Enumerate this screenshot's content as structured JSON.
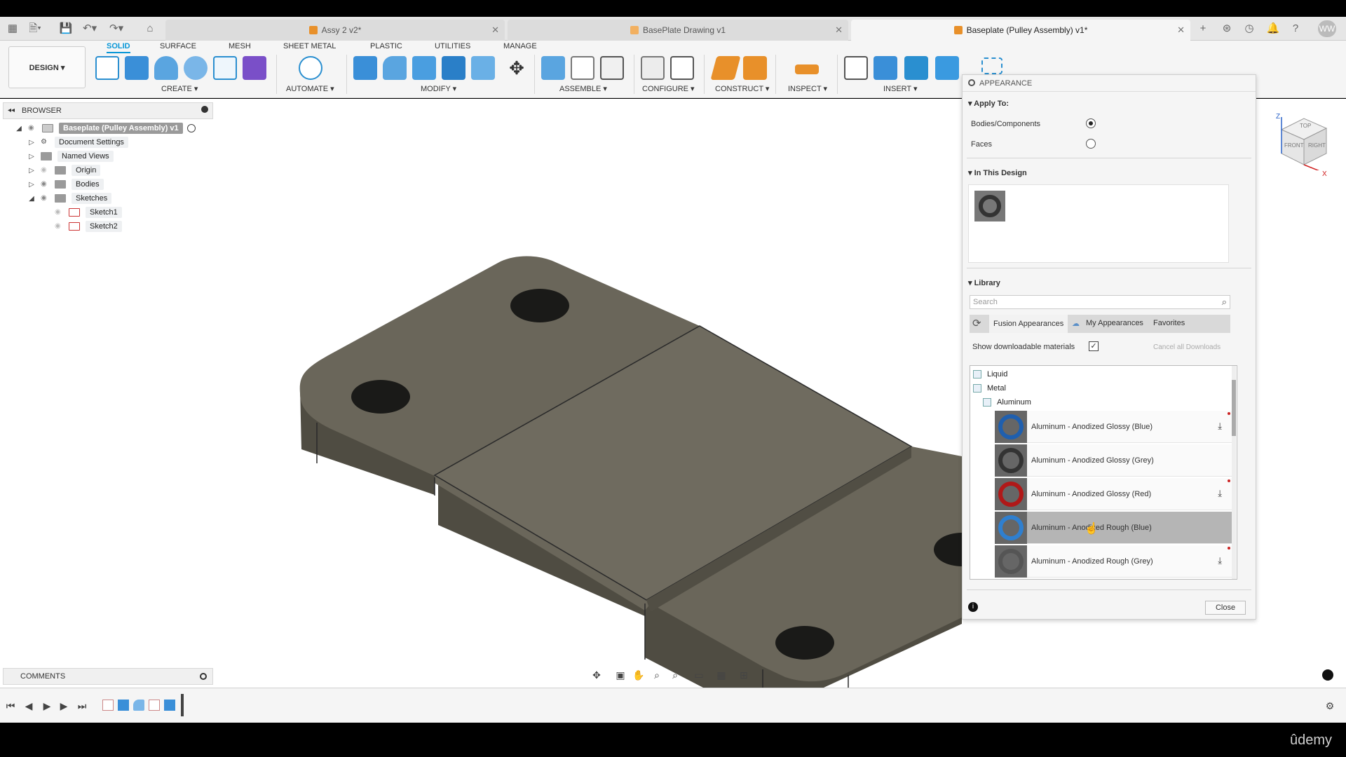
{
  "tabs": [
    {
      "label": "Assy 2 v2*"
    },
    {
      "label": "BasePlate Drawing v1"
    },
    {
      "label": "Baseplate (Pulley Assembly) v1*"
    }
  ],
  "user_initials": "WW",
  "workspace_tabs": [
    "SOLID",
    "SURFACE",
    "MESH",
    "SHEET METAL",
    "PLASTIC",
    "UTILITIES",
    "MANAGE"
  ],
  "design_button": "DESIGN ▾",
  "groups": [
    "CREATE ▾",
    "AUTOMATE ▾",
    "MODIFY ▾",
    "ASSEMBLE ▾",
    "CONFIGURE ▾",
    "CONSTRUCT ▾",
    "INSPECT ▾",
    "INSERT ▾"
  ],
  "browser": {
    "title": "BROWSER",
    "root": "Baseplate (Pulley Assembly) v1",
    "items": [
      {
        "label": "Document Settings"
      },
      {
        "label": "Named Views"
      },
      {
        "label": "Origin"
      },
      {
        "label": "Bodies"
      },
      {
        "label": "Sketches"
      },
      {
        "label": "Sketch1"
      },
      {
        "label": "Sketch2"
      }
    ]
  },
  "appearance": {
    "title": "APPEARANCE",
    "apply_to_label": "Apply To:",
    "option_bodies": "Bodies/Components",
    "option_faces": "Faces",
    "in_design_label": "In This Design",
    "library_label": "Library",
    "search_placeholder": "Search",
    "lib_tabs": [
      "Fusion Appearances",
      "My Appearances",
      "Favorites"
    ],
    "show_downloadable": "Show downloadable materials",
    "cancel_downloads": "Cancel all Downloads",
    "tree": [
      "Liquid",
      "Metal",
      "Aluminum"
    ],
    "materials": [
      {
        "label": "Aluminum - Anodized Glossy (Blue)",
        "color": "#1f5fae"
      },
      {
        "label": "Aluminum - Anodized Glossy (Grey)",
        "color": "#333333"
      },
      {
        "label": "Aluminum - Anodized Glossy (Red)",
        "color": "#b01818"
      },
      {
        "label": "Aluminum - Anodized Rough (Blue)",
        "color": "#2f7fcf"
      },
      {
        "label": "Aluminum - Anodized Rough (Grey)",
        "color": "#555555"
      }
    ],
    "close_label": "Close"
  },
  "viewcube": {
    "top": "TOP",
    "front": "FRONT",
    "right": "RIGHT",
    "z": "Z",
    "x": "X"
  },
  "comments_label": "COMMENTS",
  "watermark": "ûdemy"
}
